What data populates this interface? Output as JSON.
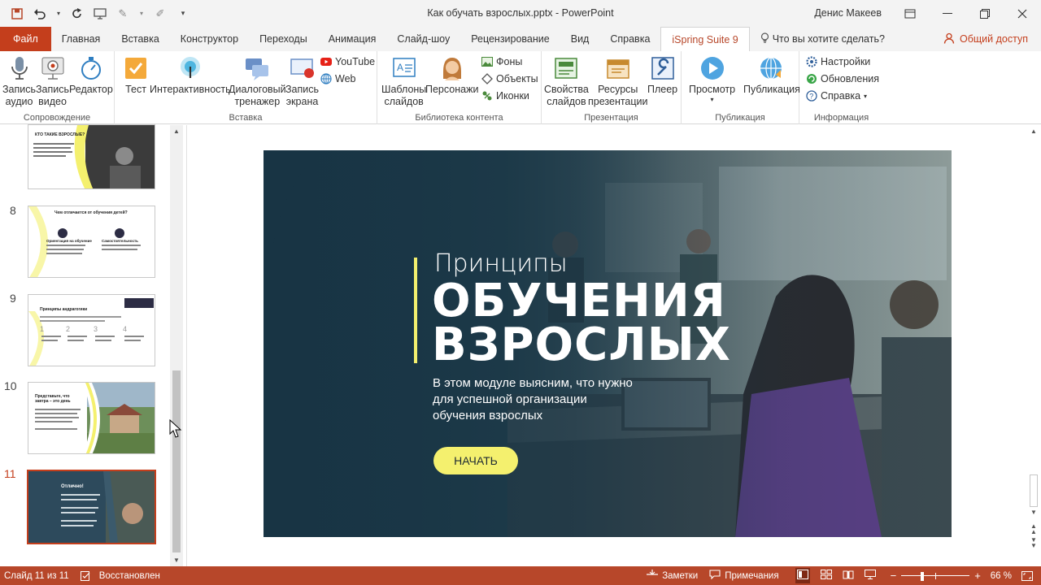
{
  "titlebar": {
    "document": "Как обучать взрослых.pptx",
    "separator": " - ",
    "app": "PowerPoint",
    "user": "Денис Макеев"
  },
  "tabs": [
    "Файл",
    "Главная",
    "Вставка",
    "Конструктор",
    "Переходы",
    "Анимация",
    "Слайд-шоу",
    "Рецензирование",
    "Вид",
    "Справка",
    "iSpring Suite 9"
  ],
  "tell_me": "Что вы хотите сделать?",
  "share": "Общий доступ",
  "ribbon": {
    "groups": {
      "narration": "Сопровождение",
      "insert": "Вставка",
      "library": "Библиотека контента",
      "presentation": "Презентация",
      "publish": "Публикация",
      "info": "Информация"
    },
    "buttons": {
      "record_audio": [
        "Запись",
        "аудио"
      ],
      "record_video": [
        "Запись",
        "видео"
      ],
      "editor": [
        "Редактор",
        ""
      ],
      "quiz": "Тест",
      "interactivity": "Интерактивность",
      "dialog_sim": [
        "Диалоговый",
        "тренажер"
      ],
      "screen_record": [
        "Запись",
        "экрана"
      ],
      "youtube": "YouTube",
      "web": "Web",
      "templates": [
        "Шаблоны",
        "слайдов"
      ],
      "characters": "Персонажи",
      "backgrounds": "Фоны",
      "objects": "Объекты",
      "icons": "Иконки",
      "properties": [
        "Свойства",
        "слайдов"
      ],
      "resources": [
        "Ресурсы",
        "презентации"
      ],
      "player": "Плеер",
      "preview": "Просмотр",
      "publish": "Публикация",
      "settings": "Настройки",
      "updates": "Обновления",
      "help": "Справка"
    }
  },
  "thumbnails": [
    {
      "num": "",
      "title": "КТО ТАКИЕ ВЗРОСЛЫЕ?"
    },
    {
      "num": "8",
      "title": "Чем отличается от обучения детей?",
      "col1": "Ориентация на обучение",
      "col2": "Самостоятельность"
    },
    {
      "num": "9",
      "title": "Принципы андрагогики",
      "steps": [
        "1",
        "2",
        "3",
        "4"
      ]
    },
    {
      "num": "10",
      "title": "Представьте, что завтра – это день"
    },
    {
      "num": "11",
      "title": "Отлично!"
    }
  ],
  "slide": {
    "kicker": "Принципы",
    "headline1": "ОБУЧЕНИЯ",
    "headline2": "ВЗРОСЛЫХ",
    "body": [
      "В этом модуле выясним, что нужно",
      "для успешной организации",
      "обучения взрослых"
    ],
    "cta": "НАЧАТЬ"
  },
  "status": {
    "slide_of": "Слайд 11 из 11",
    "recovered": "Восстановлен",
    "notes": "Заметки",
    "comments": "Примечания",
    "zoom": "66 %",
    "zoom_value": 0.66
  },
  "colors": {
    "accent": "#c43e1c",
    "ispring": "#b7472a",
    "slide_yellow": "#f4f06e"
  }
}
